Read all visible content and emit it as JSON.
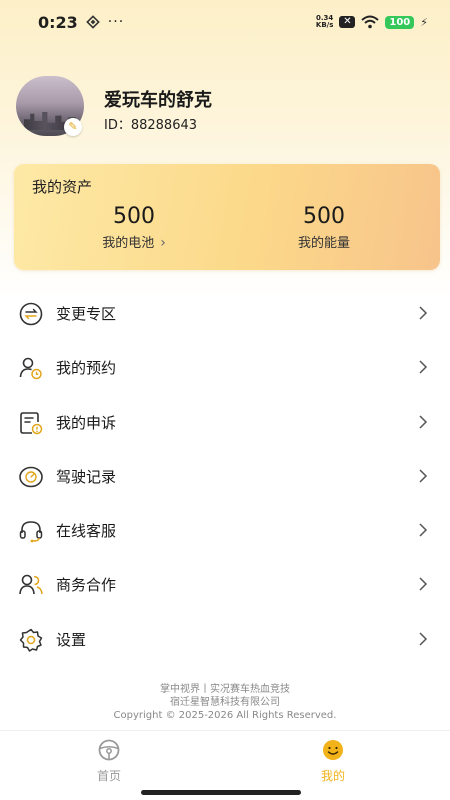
{
  "status_bar": {
    "time": "0:23",
    "dots": "···",
    "net_speed_value": "0.34",
    "net_speed_unit": "KB/s",
    "battery": "100"
  },
  "profile": {
    "nickname": "爱玩车的舒克",
    "id_text": "ID：88288643"
  },
  "assets": {
    "title": "我的资产",
    "battery": {
      "value": "500",
      "label": "我的电池"
    },
    "energy": {
      "value": "500",
      "label": "我的能量"
    }
  },
  "menu": [
    {
      "label": "变更专区",
      "icon": "change-icon"
    },
    {
      "label": "我的预约",
      "icon": "user-clock-icon"
    },
    {
      "label": "我的申诉",
      "icon": "complaint-icon"
    },
    {
      "label": "驾驶记录",
      "icon": "driving-record-icon"
    },
    {
      "label": "在线客服",
      "icon": "headset-icon"
    },
    {
      "label": "商务合作",
      "icon": "partners-icon"
    },
    {
      "label": "设置",
      "icon": "settings-icon"
    }
  ],
  "footer": {
    "line1": "掌中视界丨实况赛车热血竞技",
    "line2": "宿迁星智慧科技有限公司",
    "line3": "Copyright © 2025-2026 All Rights Reserved."
  },
  "tabs": {
    "home": "首页",
    "mine": "我的"
  },
  "colors": {
    "accent": "#f2b21a",
    "card_start": "#fde9a6",
    "card_end": "#f7c48b",
    "battery_green": "#34c759"
  }
}
